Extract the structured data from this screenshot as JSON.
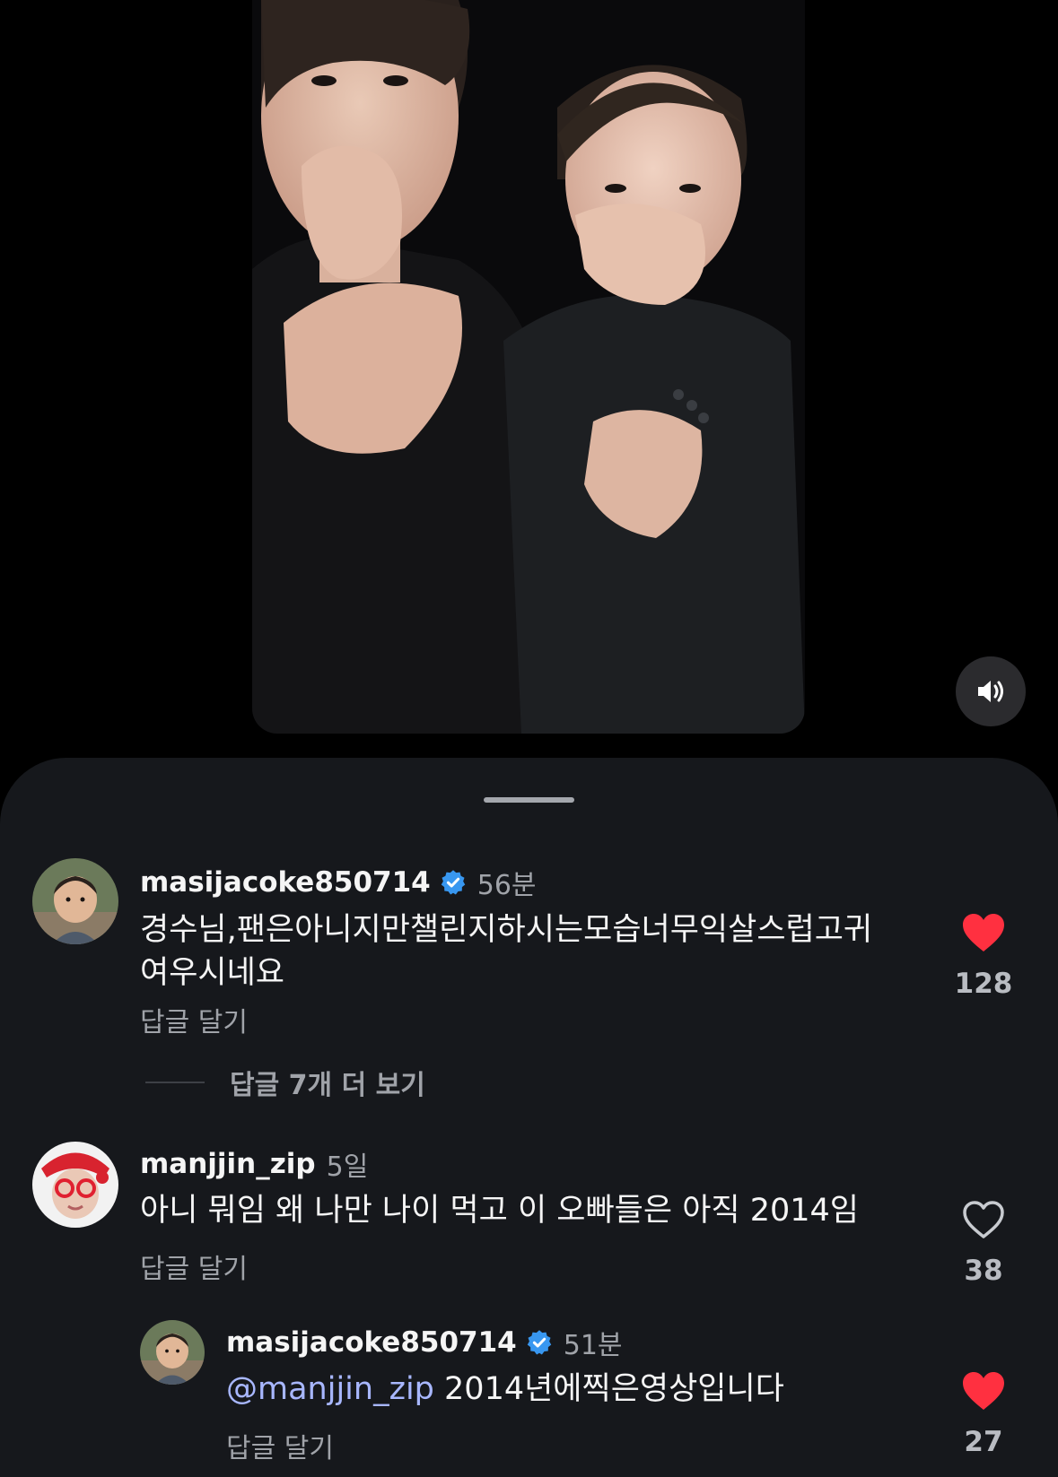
{
  "video": {
    "mute_icon": "speaker-on-icon"
  },
  "comments": [
    {
      "username": "masijacoke850714",
      "verified": true,
      "time": "56분",
      "text_line1": "경수님,팬은아니지만챌린지하시는모습너무익살스럽고귀",
      "text_line2": "여우시네요",
      "reply_label": "답글 달기",
      "liked": true,
      "like_count": "128"
    },
    {
      "username": "manjjin_zip",
      "verified": false,
      "time": "5일",
      "text": "아니 뭐임 왜 나만 나이 먹고 이 오빠들은 아직 2014임",
      "reply_label": "답글 달기",
      "liked": false,
      "like_count": "38"
    }
  ],
  "more_replies_label": "답글 7개 더 보기",
  "reply": {
    "username": "masijacoke850714",
    "verified": true,
    "time": "51분",
    "mention": "@manjjin_zip",
    "text": " 2014년에찍은영상입니다",
    "reply_label": "답글 달기",
    "liked": true,
    "like_count": "27"
  },
  "colors": {
    "sheet_bg": "#16181c",
    "heart_red": "#ff3040",
    "verified_blue": "#3897f0",
    "mention": "#a8b7ff",
    "secondary_text": "#a0a3a9"
  }
}
